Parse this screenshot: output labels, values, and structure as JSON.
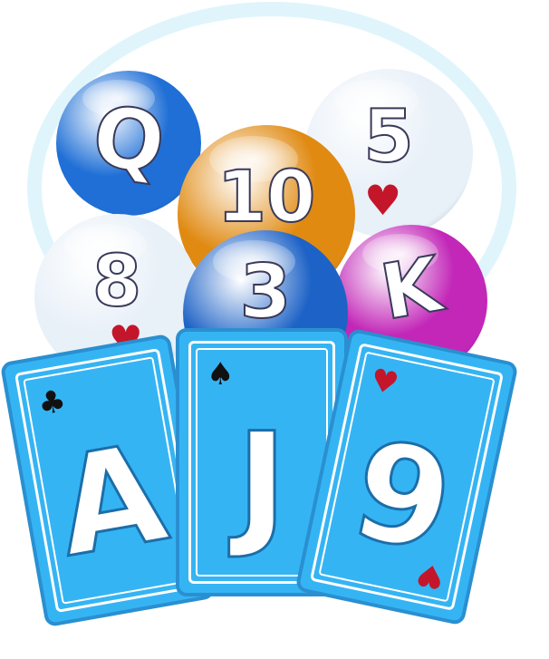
{
  "balls": [
    {
      "rank": "Q",
      "suit_icon": "heart-icon",
      "suit_glyph": "♥",
      "color": "#1f6fd6",
      "show_pip": false
    },
    {
      "rank": "10",
      "suit_icon": "heart-icon",
      "suit_glyph": "♥",
      "color": "#e08a12",
      "show_pip": false
    },
    {
      "rank": "5",
      "suit_icon": "heart-icon",
      "suit_glyph": "♥",
      "color": "#e8f0f8",
      "show_pip": true
    },
    {
      "rank": "8",
      "suit_icon": "heart-icon",
      "suit_glyph": "♥",
      "color": "#e8f0f8",
      "show_pip": true
    },
    {
      "rank": "3",
      "suit_icon": "spade-icon",
      "suit_glyph": "♠",
      "color": "#1d62c6",
      "show_pip": false
    },
    {
      "rank": "K",
      "suit_icon": "spade-icon",
      "suit_glyph": "♠",
      "color": "#c227b8",
      "show_pip": false
    }
  ],
  "cards": [
    {
      "rank": "A",
      "suit_icon": "club-icon",
      "suit_glyph": "♣",
      "suit_color": "#111111"
    },
    {
      "rank": "J",
      "suit_icon": "spade-icon",
      "suit_glyph": "♠",
      "suit_color": "#111111"
    },
    {
      "rank": "9",
      "suit_icon": "heart-icon",
      "suit_glyph": "♥",
      "suit_color": "#c4162a"
    }
  ],
  "colors": {
    "card_blue": "#35b4f4",
    "ring": "#dff5fb"
  }
}
